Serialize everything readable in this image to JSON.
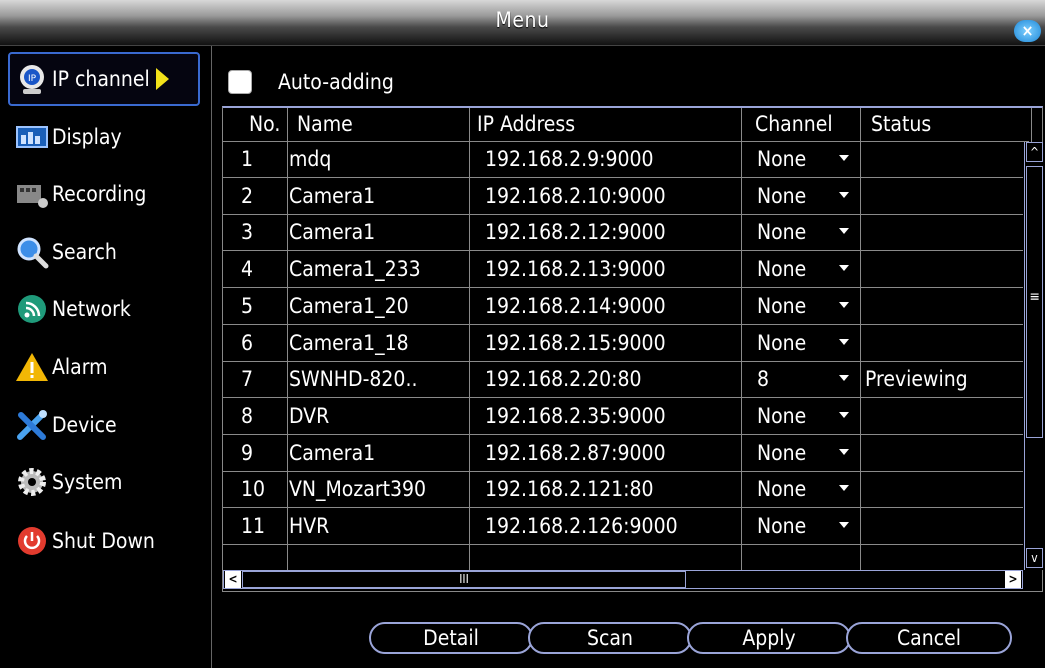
{
  "window": {
    "title": "Menu",
    "close_label": "×"
  },
  "sidebar": {
    "items": [
      {
        "label": "IP channel",
        "icon": "camera-icon",
        "active": true
      },
      {
        "label": "Display",
        "icon": "display-icon"
      },
      {
        "label": "Recording",
        "icon": "recording-icon"
      },
      {
        "label": "Search",
        "icon": "search-icon"
      },
      {
        "label": "Network",
        "icon": "network-icon"
      },
      {
        "label": "Alarm",
        "icon": "alarm-icon"
      },
      {
        "label": "Device",
        "icon": "device-icon"
      },
      {
        "label": "System",
        "icon": "system-icon"
      },
      {
        "label": "Shut Down",
        "icon": "power-icon"
      }
    ]
  },
  "auto_adding": {
    "label": "Auto-adding",
    "checked": false
  },
  "table": {
    "headers": {
      "no": "No.",
      "name": "Name",
      "ip": "IP Address",
      "channel": "Channel",
      "status": "Status"
    },
    "rows": [
      {
        "no": "1",
        "name": "mdq",
        "ip": "192.168.2.9:9000",
        "channel": "None",
        "status": ""
      },
      {
        "no": "2",
        "name": "Camera1",
        "ip": "192.168.2.10:9000",
        "channel": "None",
        "status": ""
      },
      {
        "no": "3",
        "name": "Camera1",
        "ip": "192.168.2.12:9000",
        "channel": "None",
        "status": ""
      },
      {
        "no": "4",
        "name": "Camera1_233",
        "ip": "192.168.2.13:9000",
        "channel": "None",
        "status": ""
      },
      {
        "no": "5",
        "name": "Camera1_20",
        "ip": "192.168.2.14:9000",
        "channel": "None",
        "status": ""
      },
      {
        "no": "6",
        "name": "Camera1_18",
        "ip": "192.168.2.15:9000",
        "channel": "None",
        "status": ""
      },
      {
        "no": "7",
        "name": "SWNHD-820..",
        "ip": "192.168.2.20:80",
        "channel": "8",
        "status": "Previewing"
      },
      {
        "no": "8",
        "name": "DVR",
        "ip": "192.168.2.35:9000",
        "channel": "None",
        "status": ""
      },
      {
        "no": "9",
        "name": "Camera1",
        "ip": "192.168.2.87:9000",
        "channel": "None",
        "status": ""
      },
      {
        "no": "10",
        "name": "VN_Mozart390",
        "ip": "192.168.2.121:80",
        "channel": "None",
        "status": ""
      },
      {
        "no": "11",
        "name": "HVR",
        "ip": "192.168.2.126:9000",
        "channel": "None",
        "status": ""
      }
    ]
  },
  "scrollbars": {
    "vertical_thumb_glyph": "≡",
    "horizontal_thumb_glyph": "III",
    "left_glyph": "<",
    "right_glyph": ">",
    "up_glyph": "^",
    "down_glyph": "v"
  },
  "buttons": {
    "detail": "Detail",
    "scan": "Scan",
    "apply": "Apply",
    "cancel": "Cancel"
  },
  "colors": {
    "accent_blue": "#9aa4d8",
    "active_border": "#3a6ad0",
    "arrow_yellow": "#f3e21a"
  }
}
